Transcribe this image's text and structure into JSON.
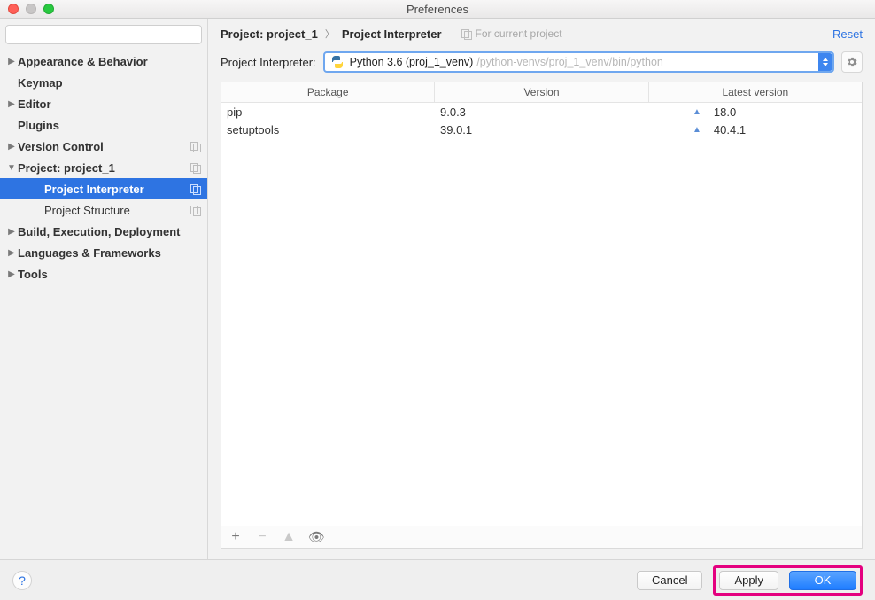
{
  "window": {
    "title": "Preferences"
  },
  "sidebar": {
    "search_placeholder": "",
    "items": [
      {
        "label": "Appearance & Behavior",
        "arrow": "▶",
        "bold": true
      },
      {
        "label": "Keymap",
        "arrow": "",
        "bold": true
      },
      {
        "label": "Editor",
        "arrow": "▶",
        "bold": true
      },
      {
        "label": "Plugins",
        "arrow": "",
        "bold": true
      },
      {
        "label": "Version Control",
        "arrow": "▶",
        "bold": true,
        "trail": true
      },
      {
        "label": "Project: project_1",
        "arrow": "▼",
        "bold": true,
        "trail": true
      },
      {
        "label": "Project Interpreter",
        "arrow": "",
        "bold": true,
        "sub": true,
        "selected": true,
        "trail": true
      },
      {
        "label": "Project Structure",
        "arrow": "",
        "bold": false,
        "sub": true,
        "trail": true
      },
      {
        "label": "Build, Execution, Deployment",
        "arrow": "▶",
        "bold": true
      },
      {
        "label": "Languages & Frameworks",
        "arrow": "▶",
        "bold": true
      },
      {
        "label": "Tools",
        "arrow": "▶",
        "bold": true
      }
    ]
  },
  "header": {
    "crumb1": "Project: project_1",
    "crumb2": "Project Interpreter",
    "scope": "For current project",
    "reset": "Reset"
  },
  "interpreter": {
    "label": "Project Interpreter:",
    "name": "Python 3.6 (proj_1_venv)",
    "path": "/python-venvs/proj_1_venv/bin/python"
  },
  "table": {
    "headers": {
      "c1": "Package",
      "c2": "Version",
      "c3": "Latest version"
    },
    "rows": [
      {
        "pkg": "pip",
        "ver": "9.0.3",
        "latest": "18.0"
      },
      {
        "pkg": "setuptools",
        "ver": "39.0.1",
        "latest": "40.4.1"
      }
    ]
  },
  "footer": {
    "cancel": "Cancel",
    "apply": "Apply",
    "ok": "OK"
  }
}
